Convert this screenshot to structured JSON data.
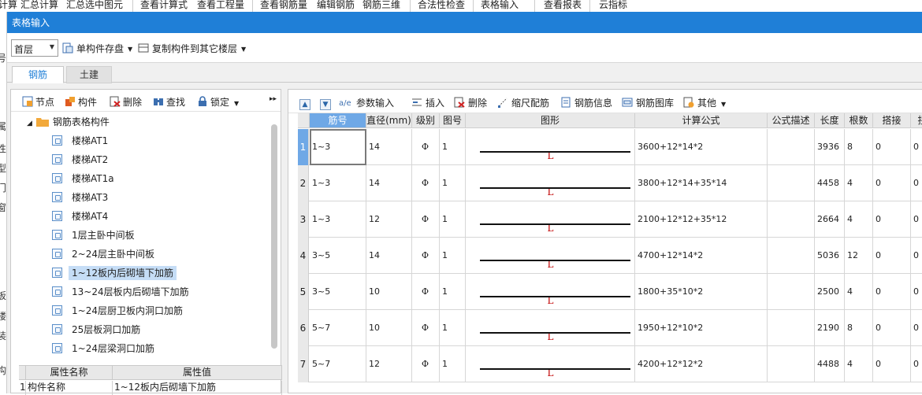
{
  "background_app": {
    "menu_items": [
      "计算",
      "汇总计算",
      "汇总选中图元",
      "查看计算式",
      "查看工程量",
      "查看钢筋量",
      "编辑钢筋",
      "钢筋三维",
      "合法性检查",
      "表格输入",
      "查看报表",
      "云指标"
    ],
    "left_fragments": [
      "号",
      "属",
      "性",
      "型",
      "门",
      "窗",
      "板",
      "楼",
      "装",
      "构"
    ]
  },
  "dialog": {
    "title": "表格输入",
    "floor": "首层",
    "toolbar": {
      "save_label": "单构件存盘",
      "copy_label": "复制构件到其它楼层"
    },
    "tabs": [
      {
        "label": "钢筋",
        "active": true
      },
      {
        "label": "土建",
        "active": false
      }
    ]
  },
  "left_panel": {
    "toolbar": {
      "node": "节点",
      "component": "构件",
      "delete": "删除",
      "find": "查找",
      "lock": "锁定",
      "more": "▸▸"
    },
    "tree": {
      "root": "钢筋表格构件",
      "items": [
        {
          "label": "楼梯AT1",
          "selected": false
        },
        {
          "label": "楼梯AT2",
          "selected": false
        },
        {
          "label": "楼梯AT1a",
          "selected": false
        },
        {
          "label": "楼梯AT3",
          "selected": false
        },
        {
          "label": "楼梯AT4",
          "selected": false
        },
        {
          "label": "1层主卧中间板",
          "selected": false
        },
        {
          "label": "2~24层主卧中间板",
          "selected": false
        },
        {
          "label": "1~12板内后砌墙下加筋",
          "selected": true
        },
        {
          "label": "13~24层板内后砌墙下加筋",
          "selected": false
        },
        {
          "label": "1~24层厨卫板内洞口加筋",
          "selected": false
        },
        {
          "label": "25层板洞口加筋",
          "selected": false
        },
        {
          "label": "1~24层梁洞口加筋",
          "selected": false
        }
      ]
    },
    "properties": {
      "headers": [
        "属性名称",
        "属性值"
      ],
      "rows": [
        {
          "num": "1",
          "name": "构件名称",
          "value": "1~12板内后砌墙下加筋"
        }
      ]
    }
  },
  "right_panel": {
    "toolbar": {
      "param_input": "参数输入",
      "insert": "插入",
      "delete": "删除",
      "scale_rebar": "缩尺配筋",
      "rebar_info": "钢筋信息",
      "rebar_library": "钢筋图库",
      "other": "其他"
    },
    "table": {
      "headers": [
        "筋号",
        "直径(mm)",
        "级别",
        "图号",
        "图形",
        "计算公式",
        "公式描述",
        "长度",
        "根数",
        "搭接",
        "拐"
      ],
      "grade_symbol": "Φ",
      "shape_label": "L",
      "rows": [
        {
          "num": "1",
          "bar": "1~3",
          "dia": "14",
          "fig": "1",
          "formula": "3600+12*14*2",
          "desc": "",
          "len": "3936",
          "count": "8",
          "lap": "0",
          "bend": "0"
        },
        {
          "num": "2",
          "bar": "1~3",
          "dia": "14",
          "fig": "1",
          "formula": "3800+12*14+35*14",
          "desc": "",
          "len": "4458",
          "count": "4",
          "lap": "0",
          "bend": "0"
        },
        {
          "num": "3",
          "bar": "1~3",
          "dia": "12",
          "fig": "1",
          "formula": "2100+12*12+35*12",
          "desc": "",
          "len": "2664",
          "count": "4",
          "lap": "0",
          "bend": "0"
        },
        {
          "num": "4",
          "bar": "3~5",
          "dia": "14",
          "fig": "1",
          "formula": "4700+12*14*2",
          "desc": "",
          "len": "5036",
          "count": "12",
          "lap": "0",
          "bend": "0"
        },
        {
          "num": "5",
          "bar": "3~5",
          "dia": "10",
          "fig": "1",
          "formula": "1800+35*10*2",
          "desc": "",
          "len": "2500",
          "count": "4",
          "lap": "0",
          "bend": "0"
        },
        {
          "num": "6",
          "bar": "5~7",
          "dia": "10",
          "fig": "1",
          "formula": "1950+12*10*2",
          "desc": "",
          "len": "2190",
          "count": "8",
          "lap": "0",
          "bend": "0"
        },
        {
          "num": "7",
          "bar": "5~7",
          "dia": "12",
          "fig": "1",
          "formula": "4200+12*12*2",
          "desc": "",
          "len": "4488",
          "count": "4",
          "lap": "0",
          "bend": "0"
        }
      ]
    }
  },
  "colors": {
    "title_bar": "#1f7fd7",
    "active_header": "#6fa8e6",
    "selected_tree": "#c5ddf6",
    "shape_label": "#c00000"
  }
}
